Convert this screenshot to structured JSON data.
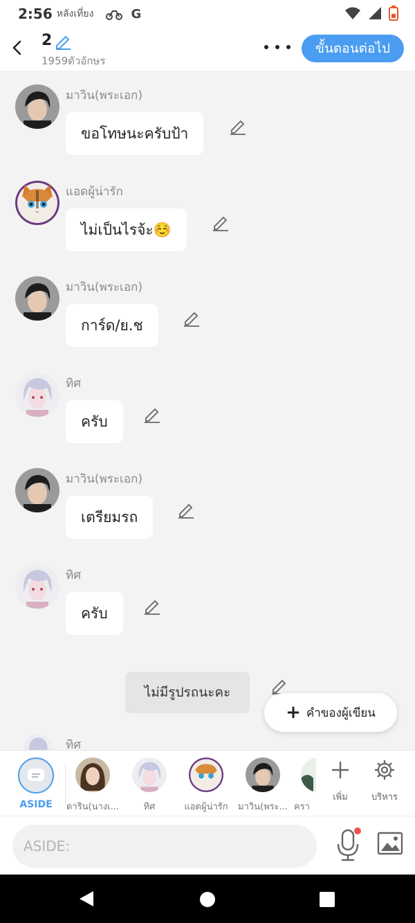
{
  "status_bar": {
    "time": "2:56",
    "period": "หลังเที่ยง",
    "app_icon_letter": "G"
  },
  "header": {
    "title": "2",
    "char_count": "1959ตัวอักษร",
    "next_button": "ขั้นตอนต่อไป"
  },
  "messages": [
    {
      "sender": "มาวิน(พระเอก)",
      "text": "ขอโทษนะครับป้า",
      "avatar": "dark-hair-boy"
    },
    {
      "sender": "แอดผู้น่ารัก",
      "text": "ไม่เป็นไรจ้ะ☺️",
      "avatar": "cat"
    },
    {
      "sender": "มาวิน(พระเอก)",
      "text": "การ์ด/ย.ช",
      "avatar": "dark-hair-boy"
    },
    {
      "sender": "ทิศ",
      "text": "ครับ",
      "avatar": "silver-hair-anime"
    },
    {
      "sender": "มาวิน(พระเอก)",
      "text": "เตรียมรถ",
      "avatar": "dark-hair-boy"
    },
    {
      "sender": "ทิศ",
      "text": "ครับ",
      "avatar": "silver-hair-anime"
    }
  ],
  "aside_message": {
    "text": "ไม่มีรูปรถนะคะ"
  },
  "partial_message": {
    "sender": "ทิศ"
  },
  "fab": {
    "label": "คำของผู้เขียน"
  },
  "character_bar": {
    "aside_label": "ASIDE",
    "characters": [
      {
        "label": "ดาริน(นางเ...",
        "avatar": "brown-hair-girl"
      },
      {
        "label": "ทิศ",
        "avatar": "silver-hair-anime"
      },
      {
        "label": "แอดผู้น่ารัก",
        "avatar": "cat"
      },
      {
        "label": "มาวิน(พระ...",
        "avatar": "dark-hair-boy"
      },
      {
        "label": "ครา",
        "avatar": "partial"
      }
    ],
    "add_label": "เพิ่ม",
    "manage_label": "บริหาร"
  },
  "input": {
    "placeholder": "ASIDE:"
  },
  "colors": {
    "accent": "#4a9df0",
    "background": "#f3f3f3",
    "bubble": "#ffffff",
    "record_dot": "#f05252"
  }
}
